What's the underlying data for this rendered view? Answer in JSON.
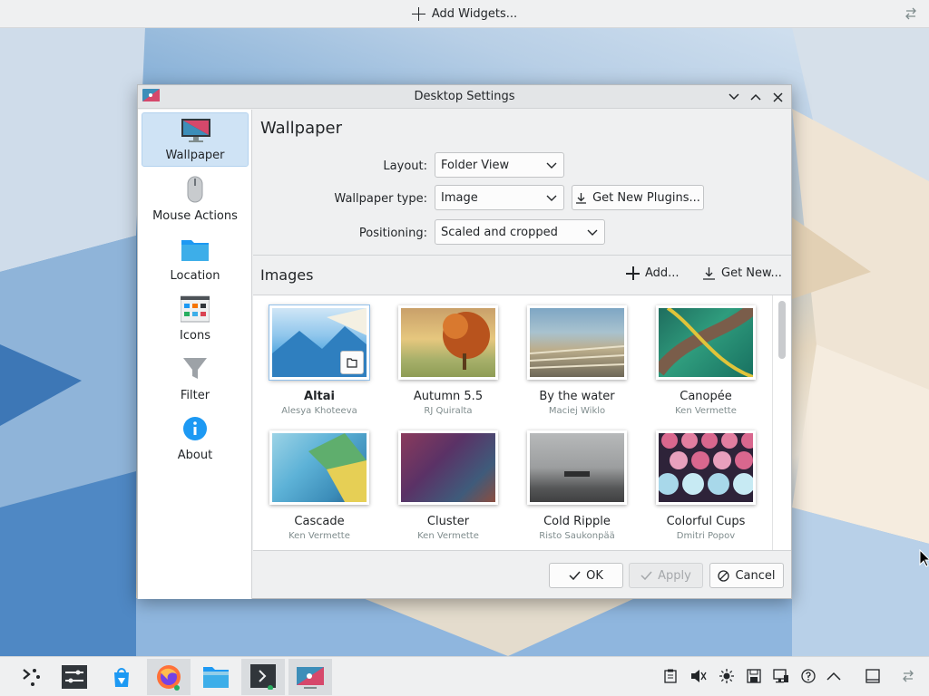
{
  "topbar": {
    "add_widgets": "Add Widgets..."
  },
  "dialog": {
    "title": "Desktop Settings",
    "sidebar": [
      {
        "label": "Wallpaper",
        "icon": "monitor-icon",
        "active": true
      },
      {
        "label": "Mouse Actions",
        "icon": "mouse-icon",
        "active": false
      },
      {
        "label": "Location",
        "icon": "folder-icon",
        "active": false
      },
      {
        "label": "Icons",
        "icon": "icons-grid-icon",
        "active": false
      },
      {
        "label": "Filter",
        "icon": "funnel-icon",
        "active": false
      },
      {
        "label": "About",
        "icon": "info-icon",
        "active": false
      }
    ],
    "page_title": "Wallpaper",
    "form": {
      "layout_label": "Layout:",
      "layout_value": "Folder View",
      "type_label": "Wallpaper type:",
      "type_value": "Image",
      "get_plugins": "Get New Plugins...",
      "positioning_label": "Positioning:",
      "positioning_value": "Scaled and cropped"
    },
    "images": {
      "header": "Images",
      "add": "Add...",
      "get_new": "Get New...",
      "items": [
        {
          "name": "Altai",
          "author": "Alesya Khoteeva",
          "selected": true
        },
        {
          "name": "Autumn 5.5",
          "author": "RJ Quiralta",
          "selected": false
        },
        {
          "name": "By the water",
          "author": "Maciej Wiklo",
          "selected": false
        },
        {
          "name": "Canopée",
          "author": "Ken Vermette",
          "selected": false
        },
        {
          "name": "Cascade",
          "author": "Ken Vermette",
          "selected": false
        },
        {
          "name": "Cluster",
          "author": "Ken Vermette",
          "selected": false
        },
        {
          "name": "Cold Ripple",
          "author": "Risto Saukonpää",
          "selected": false
        },
        {
          "name": "Colorful Cups",
          "author": "Dmitri Popov",
          "selected": false
        }
      ]
    },
    "buttons": {
      "ok": "OK",
      "apply": "Apply",
      "cancel": "Cancel"
    }
  },
  "taskbar": {
    "tasks": [
      "application-launcher",
      "system-settings",
      "discover",
      "firefox",
      "dolphin",
      "konsole",
      "desktop-settings"
    ],
    "tray": [
      "clipboard-icon",
      "volume-muted-icon",
      "brightness-icon",
      "save-icon",
      "network-icon",
      "help-icon",
      "expand-tray-icon",
      "show-desktop-icon",
      "panel-settings-icon"
    ]
  }
}
